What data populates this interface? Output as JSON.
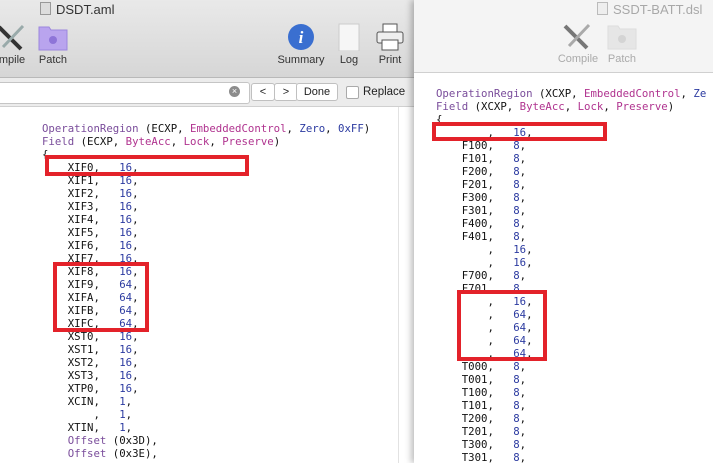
{
  "left_window": {
    "title": "DSDT.aml",
    "toolbar": {
      "compile": "mpile",
      "patch": "Patch",
      "summary": "Summary",
      "log": "Log",
      "print": "Print"
    },
    "find": {
      "value": "",
      "prev": "<",
      "next": ">",
      "done": "Done",
      "replace": "Replace",
      "replace_checked": false
    },
    "header": [
      [
        {
          "t": "OperationRegion",
          "c": "kw"
        },
        {
          "t": " (ECXP, "
        },
        {
          "t": "EmbeddedControl",
          "c": "mg"
        },
        {
          "t": ", "
        },
        {
          "t": "Zero",
          "c": "bl"
        },
        {
          "t": ", "
        },
        {
          "t": "0xFF",
          "c": "bl"
        },
        {
          "t": ")"
        }
      ],
      [
        {
          "t": "Field",
          "c": "kw"
        },
        {
          "t": " (ECXP, "
        },
        {
          "t": "ByteAcc",
          "c": "mg"
        },
        {
          "t": ", "
        },
        {
          "t": "Lock",
          "c": "mg"
        },
        {
          "t": ", "
        },
        {
          "t": "Preserve",
          "c": "mg"
        },
        {
          "t": ")"
        }
      ],
      [
        {
          "t": "{"
        }
      ]
    ],
    "fields": [
      [
        "XIF0",
        "16"
      ],
      [
        "XIF1",
        "16"
      ],
      [
        "XIF2",
        "16"
      ],
      [
        "XIF3",
        "16"
      ],
      [
        "XIF4",
        "16"
      ],
      [
        "XIF5",
        "16"
      ],
      [
        "XIF6",
        "16"
      ],
      [
        "XIF7",
        "16"
      ],
      [
        "XIF8",
        "16"
      ],
      [
        "XIF9",
        "64"
      ],
      [
        "XIFA",
        "64"
      ],
      [
        "XIFB",
        "64"
      ],
      [
        "XIFC",
        "64"
      ],
      [
        "XST0",
        "16"
      ],
      [
        "XST1",
        "16"
      ],
      [
        "XST2",
        "16"
      ],
      [
        "XST3",
        "16"
      ],
      [
        "XTP0",
        "16"
      ],
      [
        "XCIN",
        "1"
      ],
      [
        "",
        "1"
      ],
      [
        "XTIN",
        "1"
      ]
    ],
    "offsets": [
      "0x3D",
      "0x3E"
    ],
    "offset_kw": "Offset"
  },
  "right_window": {
    "title": "SSDT-BATT.dsl",
    "toolbar": {
      "compile": "Compile",
      "patch": "Patch"
    },
    "header": [
      [
        {
          "t": "OperationRegion",
          "c": "kw"
        },
        {
          "t": " (XCXP, "
        },
        {
          "t": "EmbeddedControl",
          "c": "mg"
        },
        {
          "t": ", "
        },
        {
          "t": "Ze",
          "c": "bl"
        }
      ],
      [
        {
          "t": "Field",
          "c": "kw"
        },
        {
          "t": " (XCXP, "
        },
        {
          "t": "ByteAcc",
          "c": "mg"
        },
        {
          "t": ", "
        },
        {
          "t": "Lock",
          "c": "mg"
        },
        {
          "t": ", "
        },
        {
          "t": "Preserve",
          "c": "mg"
        },
        {
          "t": ")"
        }
      ],
      [
        {
          "t": "{"
        }
      ]
    ],
    "fields": [
      [
        "",
        "16"
      ],
      [
        "F100",
        "8"
      ],
      [
        "F101",
        "8"
      ],
      [
        "F200",
        "8"
      ],
      [
        "F201",
        "8"
      ],
      [
        "F300",
        "8"
      ],
      [
        "F301",
        "8"
      ],
      [
        "F400",
        "8"
      ],
      [
        "F401",
        "8"
      ],
      [
        "",
        "16"
      ],
      [
        "",
        "16"
      ],
      [
        "F700",
        "8"
      ],
      [
        "F701",
        "8"
      ],
      [
        "",
        "16"
      ],
      [
        "",
        "64"
      ],
      [
        "",
        "64"
      ],
      [
        "",
        "64"
      ],
      [
        "",
        "64"
      ],
      [
        "T000",
        "8"
      ],
      [
        "T001",
        "8"
      ],
      [
        "T100",
        "8"
      ],
      [
        "T101",
        "8"
      ],
      [
        "T200",
        "8"
      ],
      [
        "T201",
        "8"
      ],
      [
        "T300",
        "8"
      ],
      [
        "T301",
        "8"
      ]
    ]
  },
  "colors": {
    "highlight": "#e3222a",
    "keyword": "#7a4d9b",
    "constant": "#b0338f",
    "number": "#2b3aa0"
  }
}
